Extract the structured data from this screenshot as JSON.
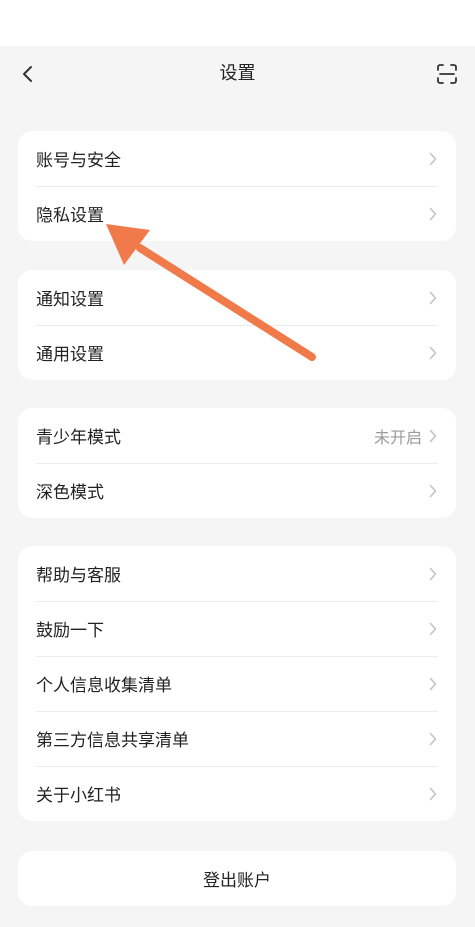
{
  "nav": {
    "title": "设置"
  },
  "groups": [
    {
      "items": [
        {
          "label": "账号与安全"
        },
        {
          "label": "隐私设置"
        }
      ]
    },
    {
      "items": [
        {
          "label": "通知设置"
        },
        {
          "label": "通用设置"
        }
      ]
    },
    {
      "items": [
        {
          "label": "青少年模式",
          "value": "未开启"
        },
        {
          "label": "深色模式"
        }
      ]
    },
    {
      "items": [
        {
          "label": "帮助与客服"
        },
        {
          "label": "鼓励一下"
        },
        {
          "label": "个人信息收集清单"
        },
        {
          "label": "第三方信息共享清单"
        },
        {
          "label": "关于小红书"
        }
      ]
    }
  ],
  "logout": {
    "label": "登出账户"
  },
  "colors": {
    "annotation_arrow": "#f07a4a",
    "background": "#f5f5f5",
    "card": "#ffffff"
  }
}
